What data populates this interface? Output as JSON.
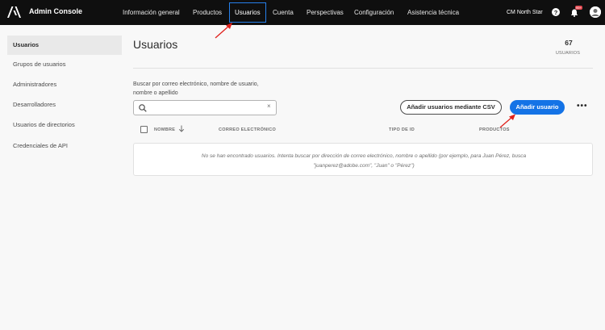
{
  "header": {
    "app_title": "Admin Console",
    "nav": [
      "Información general",
      "Productos",
      "Usuarios",
      "Cuenta",
      "Perspectivas",
      "Configuración",
      "Asistencia técnica"
    ],
    "active_nav": "Usuarios",
    "org_name": "CM North Star",
    "notification_count": "99+",
    "icons": [
      "adobe-logo",
      "help-icon",
      "bell-icon",
      "avatar"
    ]
  },
  "sidebar": {
    "items": [
      "Usuarios",
      "Grupos de usuarios",
      "Administradores",
      "Desarrolladores",
      "Usuarios de directorios",
      "Credenciales de API"
    ],
    "selected": "Usuarios"
  },
  "main": {
    "title": "Usuarios",
    "count": "67",
    "count_label": "USUARIOS",
    "search_label": "Buscar por correo electrónico, nombre de usuario, nombre o apellido",
    "search_value": "",
    "csv_button": "Añadir usuarios mediante CSV",
    "add_button": "Añadir usuario",
    "more_label": "•••",
    "columns": [
      "NOMBRE",
      "CORREO ELECTRÓNICO",
      "TIPO DE ID",
      "PRODUCTOS"
    ],
    "empty_message": "No se han encontrado usuarios. Intenta buscar por dirección de correo electrónico, nombre o apellido (por ejemplo, para Juan Pérez, busca \"juanperez@adobe.com\", \"Juan\" o \"Pérez\")"
  },
  "colors": {
    "accent": "#1473e6",
    "topbar": "#0f0f0f",
    "annotation": "#e0201b"
  }
}
